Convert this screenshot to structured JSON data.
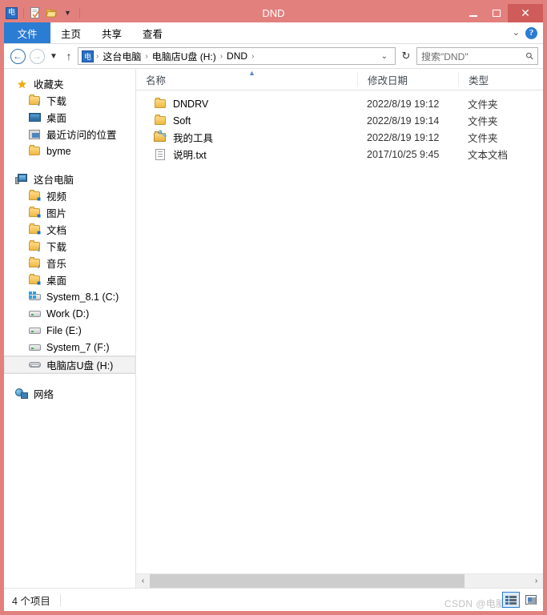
{
  "window": {
    "title": "DND",
    "accent_color": "#e2807e",
    "close_color": "#cf5c5a",
    "tab_accent": "#2b7cd3"
  },
  "quick_access_toolbar": {
    "window_icon": "电",
    "items": [
      {
        "name": "properties-icon",
        "glyph": ""
      },
      {
        "name": "new-folder-icon",
        "glyph": ""
      },
      {
        "name": "customize-qat-dropdown",
        "glyph": "▼"
      }
    ]
  },
  "window_controls": {
    "minimize": "—",
    "maximize": "▢",
    "close": "✕"
  },
  "ribbon": {
    "tabs": [
      {
        "label": "文件",
        "active": true
      },
      {
        "label": "主页",
        "active": false
      },
      {
        "label": "共享",
        "active": false
      },
      {
        "label": "查看",
        "active": false
      }
    ],
    "expand_chevron": "⌄",
    "help_label": "?"
  },
  "navigation": {
    "back": "←",
    "forward": "→",
    "recent_dropdown": "▼",
    "up": "↑",
    "refresh": "↻",
    "address_dropdown": "⌄",
    "breadcrumb_icon": "电",
    "breadcrumb": [
      {
        "label": "这台电脑"
      },
      {
        "label": "电脑店U盘 (H:)"
      },
      {
        "label": "DND"
      }
    ],
    "crumb_separator": "›"
  },
  "search": {
    "placeholder": "搜索\"DND\"",
    "icon": "search-icon"
  },
  "sidebar": {
    "groups": [
      {
        "name": "favorites",
        "root": {
          "label": "收藏夹",
          "icon": "star-icon"
        },
        "items": [
          {
            "label": "下载",
            "icon": "folder-download-icon"
          },
          {
            "label": "桌面",
            "icon": "desktop-icon"
          },
          {
            "label": "最近访问的位置",
            "icon": "recent-places-icon"
          },
          {
            "label": "byme",
            "icon": "folder-icon"
          }
        ]
      },
      {
        "name": "this-pc",
        "root": {
          "label": "这台电脑",
          "icon": "computer-icon"
        },
        "items": [
          {
            "label": "视频",
            "icon": "folder-video-icon"
          },
          {
            "label": "图片",
            "icon": "folder-pictures-icon"
          },
          {
            "label": "文档",
            "icon": "folder-documents-icon"
          },
          {
            "label": "下载",
            "icon": "folder-download-icon"
          },
          {
            "label": "音乐",
            "icon": "folder-music-icon"
          },
          {
            "label": "桌面",
            "icon": "folder-desktop-icon"
          },
          {
            "label": "System_8.1 (C:)",
            "icon": "windows-drive-icon"
          },
          {
            "label": "Work (D:)",
            "icon": "drive-icon"
          },
          {
            "label": "File (E:)",
            "icon": "drive-icon"
          },
          {
            "label": "System_7 (F:)",
            "icon": "drive-icon"
          },
          {
            "label": "电脑店U盘 (H:)",
            "icon": "usb-drive-icon",
            "selected": true
          }
        ]
      },
      {
        "name": "network",
        "root": {
          "label": "网络",
          "icon": "network-icon"
        },
        "items": []
      }
    ]
  },
  "file_list": {
    "columns": [
      {
        "key": "name",
        "label": "名称",
        "sorted": true,
        "sort_arrow": "▲"
      },
      {
        "key": "date",
        "label": "修改日期"
      },
      {
        "key": "type",
        "label": "类型"
      }
    ],
    "rows": [
      {
        "name": "DNDRV",
        "date": "2022/8/19 19:12",
        "type": "文件夹",
        "icon": "folder-icon"
      },
      {
        "name": "Soft",
        "date": "2022/8/19 19:14",
        "type": "文件夹",
        "icon": "folder-icon"
      },
      {
        "name": "我的工具",
        "date": "2022/8/19 19:12",
        "type": "文件夹",
        "icon": "folder-tools-icon"
      },
      {
        "name": "说明.txt",
        "date": "2017/10/25 9:45",
        "type": "文本文档",
        "icon": "text-document-icon"
      }
    ]
  },
  "scrollbar": {
    "left_arrow": "‹",
    "right_arrow": "›"
  },
  "status_bar": {
    "item_count_text": "4 个项目",
    "view_buttons": [
      {
        "name": "details-view-button",
        "active": true
      },
      {
        "name": "large-icons-view-button",
        "active": false
      }
    ]
  },
  "watermark": {
    "text": "CSDN @电脑侠"
  }
}
